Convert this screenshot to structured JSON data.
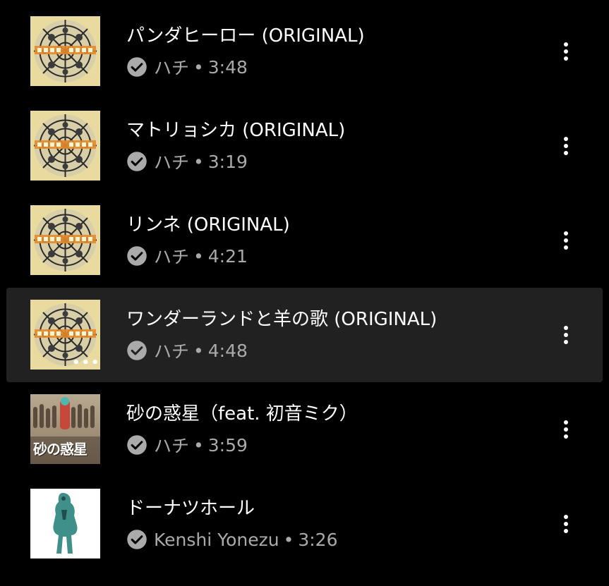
{
  "tracks": [
    {
      "title": "パンダヒーロー (ORIGINAL)",
      "artist": "ハチ",
      "separator": "•",
      "duration": "3:48",
      "thumbnail_icon": "official-orange-album-art",
      "active": false
    },
    {
      "title": "マトリョシカ (ORIGINAL)",
      "artist": "ハチ",
      "separator": "•",
      "duration": "3:19",
      "thumbnail_icon": "official-orange-album-art",
      "active": false
    },
    {
      "title": "リンネ (ORIGINAL)",
      "artist": "ハチ",
      "separator": "•",
      "duration": "4:21",
      "thumbnail_icon": "official-orange-album-art",
      "active": false
    },
    {
      "title": "ワンダーランドと羊の歌 (ORIGINAL)",
      "artist": "ハチ",
      "separator": "•",
      "duration": "4:48",
      "thumbnail_icon": "official-orange-album-art",
      "active": true
    },
    {
      "title": "砂の惑星（feat. 初音ミク）",
      "artist": "ハチ",
      "separator": "•",
      "duration": "3:59",
      "thumbnail_icon": "suna-no-wakusei-album-art",
      "thumbnail_text": "砂の惑星",
      "active": false
    },
    {
      "title": "ドーナツホール",
      "artist": "Kenshi Yonezu",
      "separator": "•",
      "duration": "3:26",
      "thumbnail_icon": "donut-hole-album-art",
      "active": false
    }
  ],
  "colors": {
    "background": "#000000",
    "active_row": "#212121",
    "title_text": "#ffffff",
    "subtitle_text": "#aaaaaa"
  },
  "icons": {
    "verified": "verified-check-circle-icon",
    "menu": "more-vert-icon"
  }
}
